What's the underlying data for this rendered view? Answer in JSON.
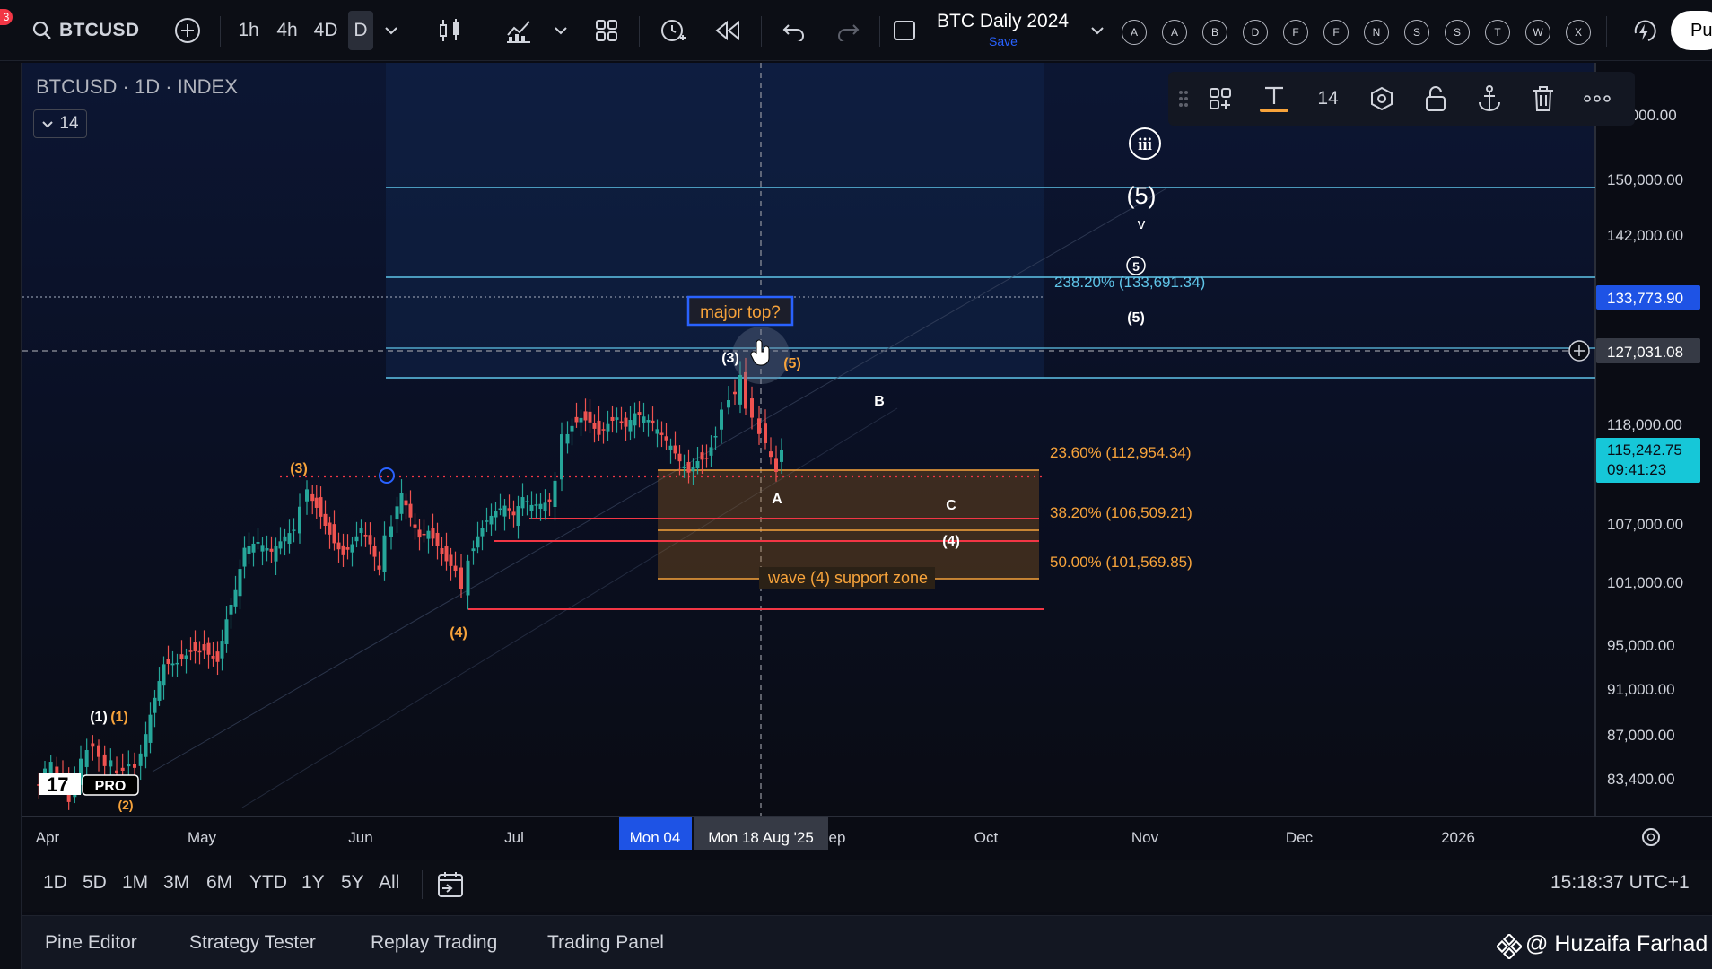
{
  "toolbar": {
    "badge": "3",
    "symbol": "BTCUSD",
    "timeframes": [
      "1h",
      "4h",
      "4D",
      "D"
    ],
    "active_timeframe": "D",
    "layout_title": "BTC Daily 2024",
    "layout_save": "Save",
    "letter_buttons": [
      "A",
      "A",
      "B",
      "D",
      "F",
      "F",
      "N",
      "S",
      "S",
      "T",
      "W",
      "X"
    ],
    "publish_label": "Pu"
  },
  "chart": {
    "title": "BTCUSD · 1D · INDEX",
    "legend_count": "14",
    "y_axis_labels": [
      "150,000.00",
      "142,000.00",
      "118,000.00",
      "107,000.00",
      "101,000.00",
      "95,000.00",
      "91,000.00",
      "87,000.00",
      "83,400.00"
    ],
    "y_axis_top_partial": ",000.00",
    "price_label_blue": "133,773.90",
    "price_label_crosshair": "127,031.08",
    "price_label_current": "115,242.75",
    "price_label_countdown": "09:41:23",
    "x_axis_labels": [
      "Apr",
      "May",
      "Jun",
      "Jul",
      "ep",
      "Oct",
      "Nov",
      "Dec",
      "2026"
    ],
    "x_axis_highlight": "Mon 04",
    "x_axis_crosshair": "Mon 18 Aug '25",
    "fib_levels": [
      {
        "label": "238.20% (133,691.34)",
        "color": "#5fc4e8"
      },
      {
        "label": "23.60% (112,954.34)",
        "color": "#f7a33b"
      },
      {
        "label": "38.20% (106,509.21)",
        "color": "#f7a33b"
      },
      {
        "label": "50.00% (101,569.85)",
        "color": "#f7a33b"
      }
    ],
    "annotations": {
      "major_top": "major top?",
      "support_zone": "wave (4) support zone",
      "wave_iii": "iii",
      "wave_5_big": "(5)",
      "wave_v": "v",
      "wave_5_circle": "5",
      "wave_5_white": "(5)",
      "wave_3_white": "(3)",
      "wave_5_orange": "(5)",
      "wave_B": "B",
      "wave_A": "A",
      "wave_C": "C",
      "wave_4_white": "(4)",
      "wave_3_orange": "(3)",
      "wave_4_orange": "(4)",
      "wave_1_white": "(1)",
      "wave_1_orange": "(1)",
      "wave_2_orange": "(2)",
      "pro_badge": "PRO"
    },
    "float_toolbar": {
      "font_size": "14"
    }
  },
  "range_bar": {
    "items": [
      "1D",
      "5D",
      "1M",
      "3M",
      "6M",
      "YTD",
      "1Y",
      "5Y",
      "All"
    ],
    "clock": "15:18:37 UTC+1"
  },
  "panel_bar": {
    "items": [
      "Pine Editor",
      "Strategy Tester",
      "Replay Trading",
      "Trading Panel"
    ],
    "handle": "@ Huzaifa Farhad"
  },
  "colors": {
    "background": "#0a0c14",
    "up_candle": "#26a69a",
    "down_candle": "#ef5350",
    "fib_cyan": "#5fc4e8",
    "fib_orange": "#f7a33b",
    "accent_blue": "#2962ff"
  }
}
